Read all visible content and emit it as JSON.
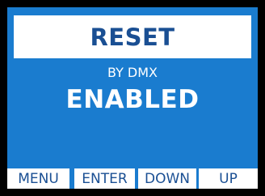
{
  "colors": {
    "bezel": "#000000",
    "screen_background": "#1a7ccf",
    "title_text": "#1a4f93",
    "text": "#ffffff",
    "softkey_background": "#ffffff",
    "softkey_text": "#1a4f93"
  },
  "screen": {
    "title": "RESET",
    "subtitle": "BY DMX",
    "value": "ENABLED"
  },
  "softkeys": {
    "menu": "MENU",
    "enter": "ENTER",
    "down": "DOWN",
    "up": "UP"
  }
}
